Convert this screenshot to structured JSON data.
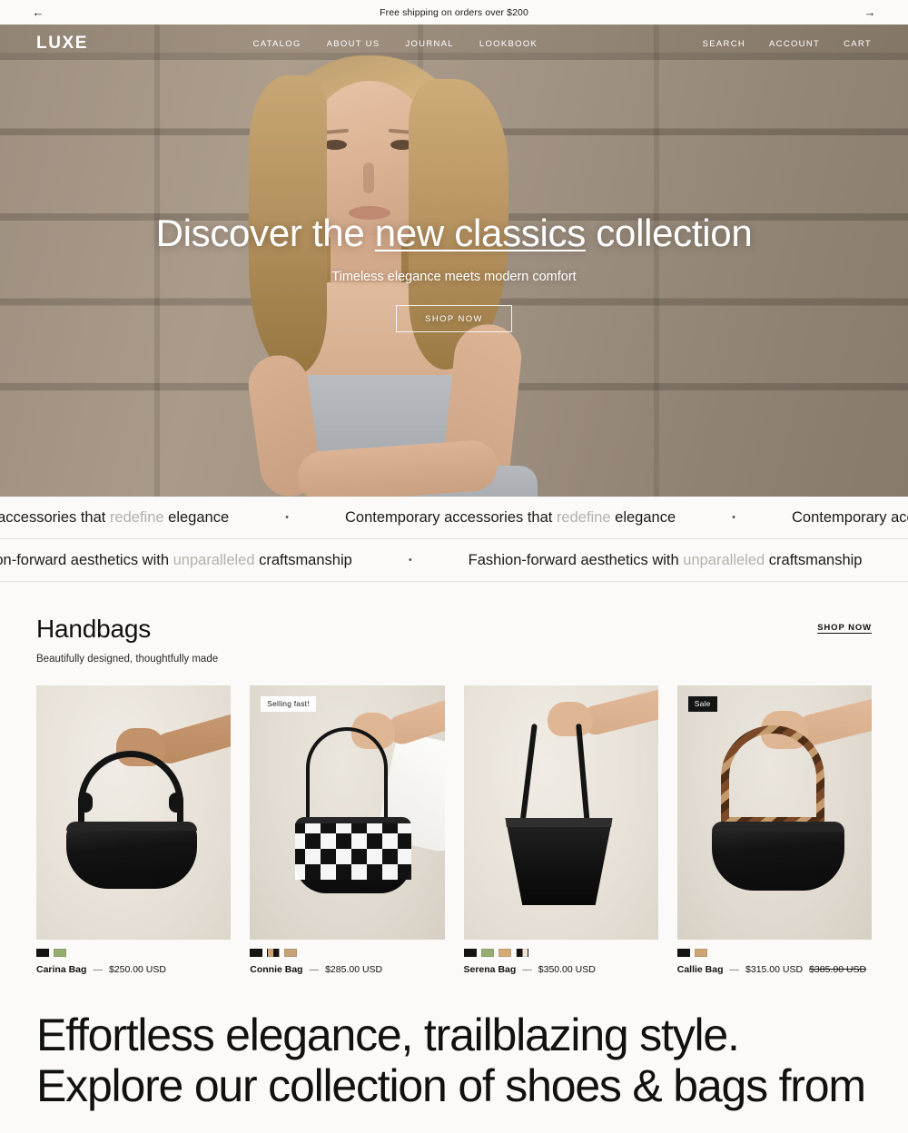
{
  "announcement": {
    "text": "Free shipping on orders over $200",
    "prev_icon": "arrow-left-icon",
    "next_icon": "arrow-right-icon",
    "prev_glyph": "←",
    "next_glyph": "→"
  },
  "header": {
    "logo": "LUXE",
    "nav": [
      {
        "label": "CATALOG"
      },
      {
        "label": "ABOUT US"
      },
      {
        "label": "JOURNAL"
      },
      {
        "label": "LOOKBOOK"
      }
    ],
    "utility": [
      {
        "label": "SEARCH"
      },
      {
        "label": "ACCOUNT"
      },
      {
        "label": "CART"
      }
    ]
  },
  "hero": {
    "title_pre": "Discover the ",
    "title_underlined": "new classics",
    "title_post": " collection",
    "subtitle": "Timeless elegance meets modern comfort",
    "button": "SHOP NOW"
  },
  "marquee": {
    "row1": {
      "pre": "Contemporary accessories that ",
      "highlight": "redefine",
      "post": " elegance",
      "separator": "•"
    },
    "row2": {
      "pre": "Fashion-forward aesthetics with ",
      "highlight": "unparalleled",
      "post": " craftsmanship",
      "separator": "•"
    }
  },
  "collection": {
    "title": "Handbags",
    "subtitle": "Beautifully designed, thoughtfully made",
    "shop_now": "SHOP NOW",
    "products": [
      {
        "name": "Carina Bag",
        "dash": "—",
        "price": "$250.00 USD",
        "compare_at": "",
        "badge": "",
        "badge_style": "",
        "swatches": [
          "#141414",
          "#95ad71"
        ]
      },
      {
        "name": "Connie Bag",
        "dash": "—",
        "price": "$285.00 USD",
        "compare_at": "",
        "badge": "Selling fast!",
        "badge_style": "light",
        "swatches": [
          "#141414",
          "#cfa474",
          "#141414",
          "#c5a277"
        ]
      },
      {
        "name": "Serena Bag",
        "dash": "—",
        "price": "$350.00 USD",
        "compare_at": "",
        "badge": "",
        "badge_style": "",
        "swatches": [
          "#141414",
          "#95ad71",
          "#d3ab79",
          "#141414",
          "#f2e3d8"
        ]
      },
      {
        "name": "Callie Bag",
        "dash": "—",
        "price": "$315.00 USD",
        "compare_at": "$385.00 USD",
        "badge": "Sale",
        "badge_style": "dark",
        "swatches": [
          "#141414",
          "#cfa474"
        ]
      }
    ]
  },
  "promo": {
    "line1": "Effortless elegance, trailblazing style.",
    "line2": "Explore our collection of shoes & bags from"
  },
  "colors": {
    "page_bg": "#fbfaf8",
    "text": "#111111",
    "muted": "#b4b1ac",
    "badge_dark": "#141414"
  }
}
